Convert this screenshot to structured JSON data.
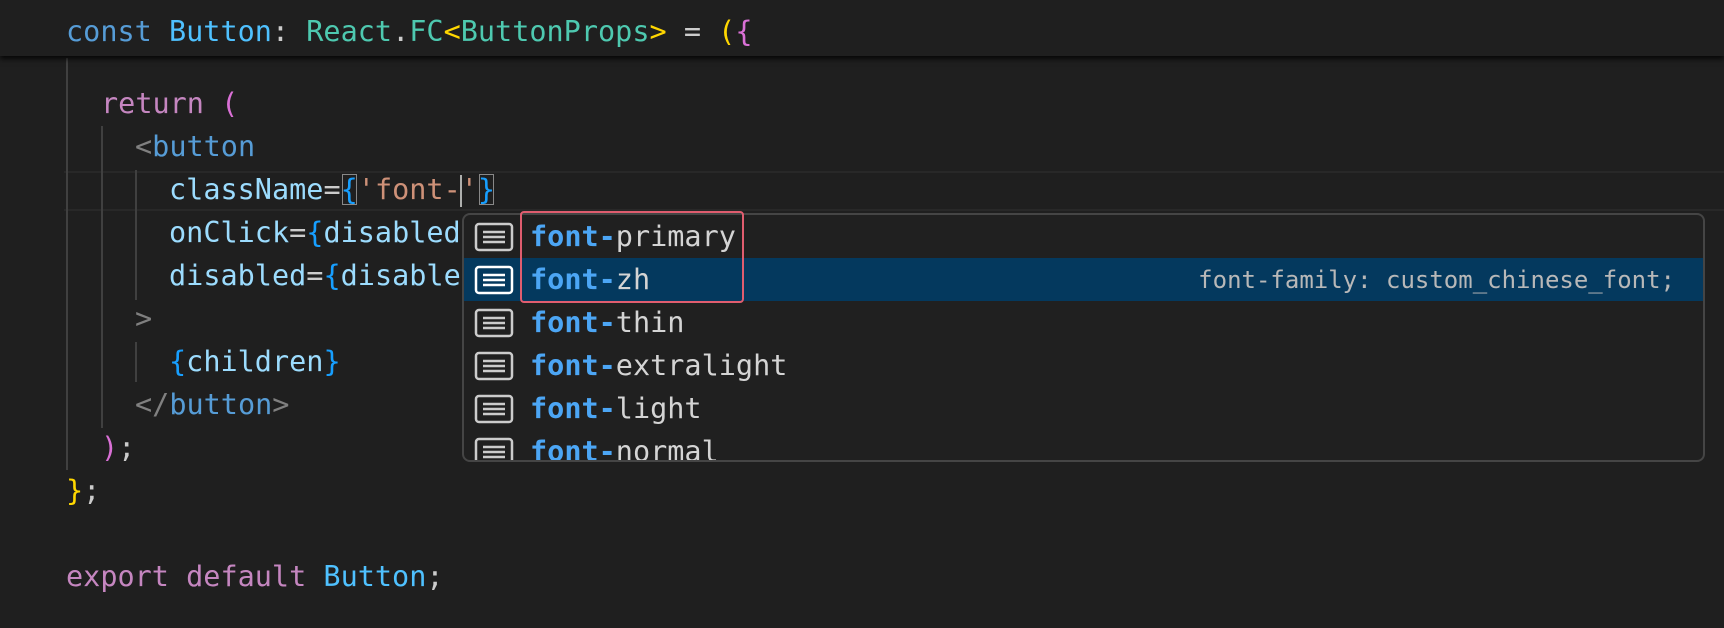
{
  "sticky": {
    "kw_const": "const",
    "name": "Button",
    "colon": ":",
    "react": "React",
    "dot": ".",
    "fc": "FC",
    "lt": "<",
    "props_type": "ButtonProps",
    "gt": ">",
    "eq": " = ",
    "paren": "(",
    "brace": "{"
  },
  "code": {
    "return_kw": "return",
    "return_paren": " (",
    "tag_open_lt": "<",
    "tag_name": "button",
    "classname_attr": "className",
    "eq": "=",
    "brace_open": "{",
    "string_value": "'font-",
    "string_close": "'",
    "brace_close": "}",
    "onclick_attr": "onClick",
    "onclick_value": "disabled",
    "disabled_attr": "disabled",
    "disabled_value": "disable",
    "gt": ">",
    "children_open": "{",
    "children": "children",
    "children_close": "}",
    "close_lt": "</",
    "close_tag_name": "button",
    "close_gt": ">",
    "close_paren": ")",
    "semicolon": ";",
    "close_brace": "}",
    "close_brace_semicolon": ";",
    "export_kw": "export",
    "default_kw": "default",
    "export_name": "Button",
    "export_semicolon": ";"
  },
  "suggest": {
    "match_prefix": "font-",
    "selected_detail": "font-family: custom_chinese_font;",
    "items": [
      {
        "rest": "primary"
      },
      {
        "rest": "zh"
      },
      {
        "rest": "thin"
      },
      {
        "rest": "extralight"
      },
      {
        "rest": "light"
      },
      {
        "rest": "normal"
      }
    ]
  },
  "colors": {
    "selected_row": "#04395e",
    "highlight_box": "#e05d6f",
    "match_text": "#4ca6f5"
  }
}
